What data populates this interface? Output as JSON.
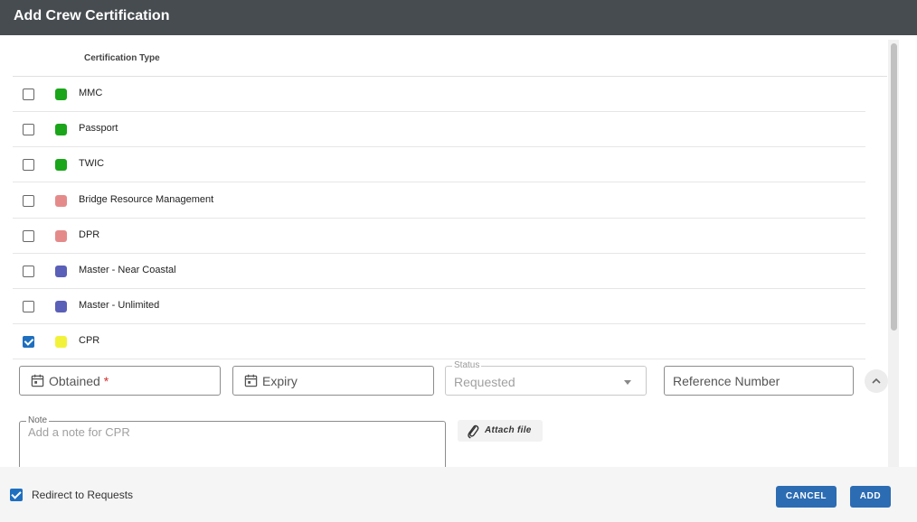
{
  "dialog": {
    "title": "Add Crew Certification"
  },
  "table": {
    "column_header": "Certification Type",
    "rows": [
      {
        "label": "MMC",
        "color": "#1aa51a",
        "checked": false
      },
      {
        "label": "Passport",
        "color": "#1aa51a",
        "checked": false
      },
      {
        "label": "TWIC",
        "color": "#1aa51a",
        "checked": false
      },
      {
        "label": "Bridge Resource Management",
        "color": "#e58a8a",
        "checked": false
      },
      {
        "label": "DPR",
        "color": "#e58a8a",
        "checked": false
      },
      {
        "label": "Master - Near Coastal",
        "color": "#5a5fb8",
        "checked": false
      },
      {
        "label": "Master - Unlimited",
        "color": "#5a5fb8",
        "checked": false
      },
      {
        "label": "CPR",
        "color": "#f2f23a",
        "checked": true
      }
    ]
  },
  "form": {
    "obtained": {
      "label": "Obtained",
      "required_mark": "*",
      "icon": "calendar-icon"
    },
    "expiry": {
      "label": "Expiry",
      "icon": "calendar-icon"
    },
    "status": {
      "label": "Status",
      "value": "Requested",
      "icon": "chevron-down-icon"
    },
    "reference": {
      "placeholder": "Reference Number"
    },
    "collapse_icon": "chevron-up-icon",
    "note": {
      "label": "Note",
      "placeholder": "Add a note for CPR"
    },
    "attach": {
      "label": "Attach file",
      "icon": "paperclip-icon"
    }
  },
  "footer": {
    "redirect_label": "Redirect to Requests",
    "redirect_checked": true,
    "cancel_label": "CANCEL",
    "add_label": "ADD"
  },
  "colors": {
    "titlebar": "#474c50",
    "primary": "#2c6cb3",
    "checkbox": "#1e6fbf"
  }
}
